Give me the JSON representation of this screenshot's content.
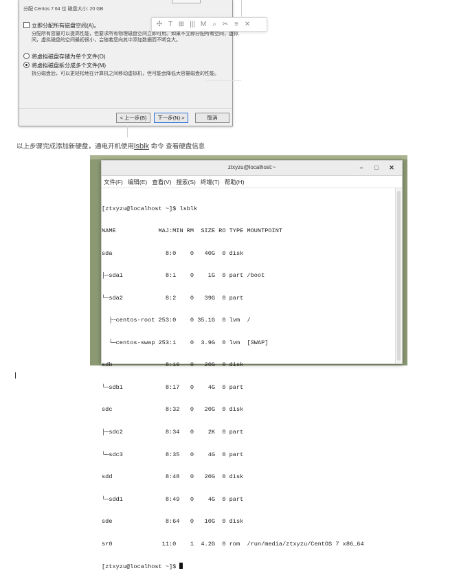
{
  "dialog": {
    "top_line": "分配 Centos 7 64 位 磁盘大小: 20 GB",
    "opt_allocate": "立即分配所有磁盘空间(A)。",
    "opt_allocate_desc1": "分配所有容量可以提高性能，但要求所有物理磁盘空间立即可用。如果不立即分配所有空间，虚拟",
    "opt_allocate_desc2": "间，虚拟磁盘的空间最初很小，会随着您向其中添加数据而不断变大。",
    "opt_single": "将虚拟磁盘存储为单个文件(O)",
    "opt_multi": "将虚拟磁盘拆分成多个文件(M)",
    "opt_multi_desc": "拆分磁盘后，可以更轻松地在计算机之间移动虚拟机，但可能会降低大容量磁盘的性能。",
    "btn_back": "< 上一步(B)",
    "btn_next": "下一步(N) >",
    "btn_cancel": "取消"
  },
  "toolbar": {
    "icons": [
      "✣",
      "T",
      "⊞",
      "|||",
      "M",
      "⌕",
      "✂",
      "≡",
      "✕"
    ]
  },
  "paragraph": {
    "before": "以上步骤完成添加新硬盘，通电开机使用",
    "link": "lsblk",
    "after": " 命令 查看硬盘信息"
  },
  "terminal": {
    "title": "ztxyzu@localhost:~",
    "btn_min": "–",
    "btn_max": "□",
    "btn_close": "✕",
    "menu": [
      "文件(F)",
      "编辑(E)",
      "查看(V)",
      "搜索(S)",
      "终端(T)",
      "帮助(H)"
    ],
    "lines": [
      "[ztxyzu@localhost ~]$ lsblk",
      "NAME            MAJ:MIN RM  SIZE RO TYPE MOUNTPOINT",
      "sda               8:0    0   40G  0 disk",
      "├─sda1            8:1    0    1G  0 part /boot",
      "└─sda2            8:2    0   39G  0 part",
      "  ├─centos-root 253:0    0 35.1G  0 lvm  /",
      "  └─centos-swap 253:1    0  3.9G  0 lvm  [SWAP]",
      "sdb               8:16   0   20G  0 disk",
      "└─sdb1            8:17   0    4G  0 part",
      "sdc               8:32   0   20G  0 disk",
      "├─sdc2            8:34   0    2K  0 part",
      "└─sdc3            8:35   0    4G  0 part",
      "sdd               8:48   0   20G  0 disk",
      "└─sdd1            8:49   0    4G  0 part",
      "sde               8:64   0   10G  0 disk",
      "sr0              11:0    1  4.2G  0 rom  /run/media/ztxyzu/CentOS 7 x86_64"
    ],
    "prompt": "[ztxyzu@localhost ~]$ "
  }
}
